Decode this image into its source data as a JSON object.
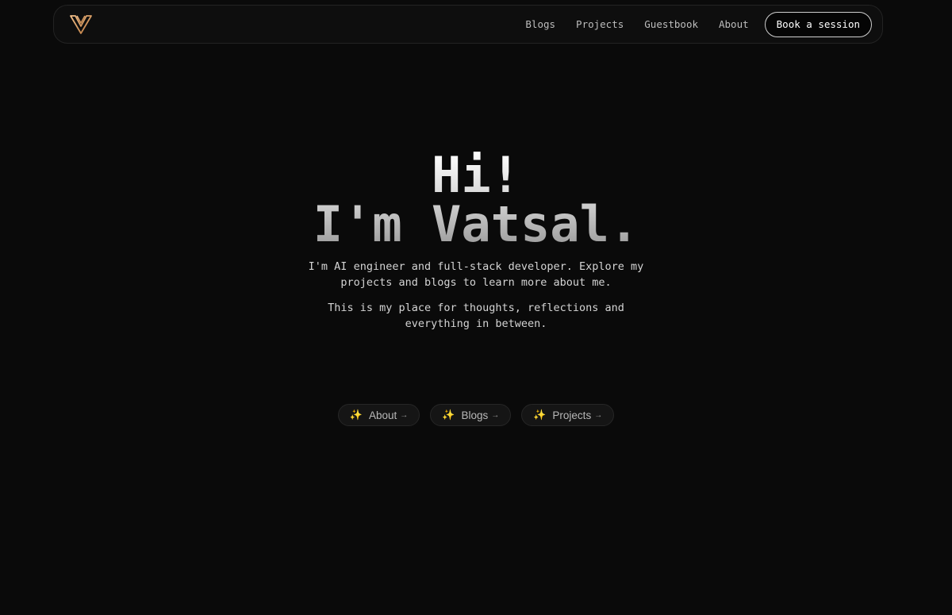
{
  "nav": {
    "logo_icon": "v-monogram-icon",
    "links": [
      "Blogs",
      "Projects",
      "Guestbook",
      "About"
    ],
    "cta_label": "Book a session"
  },
  "hero": {
    "title_line1": "Hi!",
    "title_line2": "I'm Vatsal.",
    "intro": "I'm AI engineer and full-stack developer. Explore my projects and blogs to learn more about me.",
    "intro2": "This is my place for thoughts, reflections and everything in between."
  },
  "ctas": [
    {
      "label": "About",
      "icon": "sparkle-icon",
      "arrow": "→"
    },
    {
      "label": "Blogs",
      "icon": "sparkle-icon",
      "arrow": "→"
    },
    {
      "label": "Projects",
      "icon": "sparkle-icon",
      "arrow": "→"
    }
  ],
  "colors": {
    "background": "#0a0a0a",
    "accent": "#e0a060"
  }
}
